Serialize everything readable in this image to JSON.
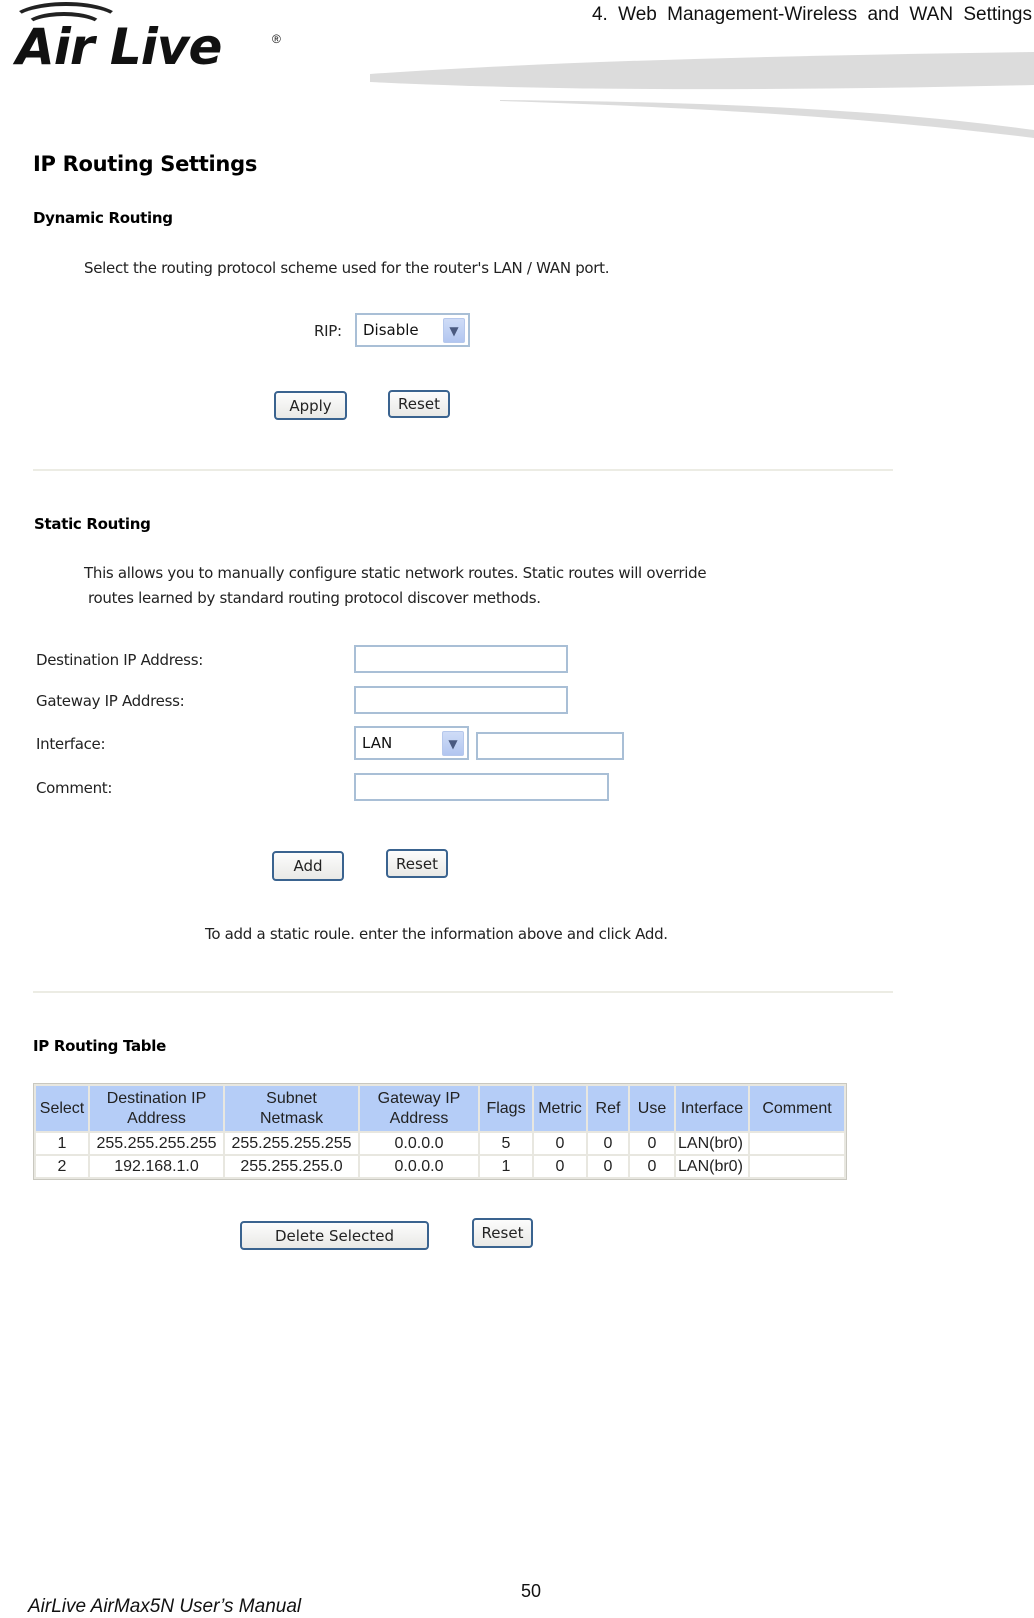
{
  "header": {
    "logo_text": "Air Live",
    "logo_mark": "®",
    "chapter_title": "4. Web Management-Wireless and WAN Settings"
  },
  "page": {
    "title": "IP Routing Settings",
    "dynamic_routing": {
      "heading": "Dynamic Routing",
      "description": "Select the routing protocol scheme used for the router's LAN / WAN port.",
      "rip_label": "RIP:",
      "rip_value": "Disable",
      "apply_label": "Apply",
      "reset_label": "Reset"
    },
    "static_routing": {
      "heading": "Static Routing",
      "description_line1": "This allows you to manually configure static network routes. Static routes will override",
      "description_line2": "routes learned by standard routing protocol discover methods.",
      "fields": {
        "destination_label": "Destination IP Address:",
        "destination_value": "",
        "gateway_label": "Gateway IP Address:",
        "gateway_value": "",
        "interface_label": "Interface:",
        "interface_value": "LAN",
        "interface_extra_value": "",
        "comment_label": "Comment:",
        "comment_value": ""
      },
      "add_label": "Add",
      "reset_label": "Reset",
      "hint": "To add a static roule. enter the information above and click Add."
    },
    "routing_table": {
      "heading": "IP Routing Table",
      "columns": [
        [
          "Select"
        ],
        [
          "Destination IP",
          "Address"
        ],
        [
          "Subnet",
          "Netmask"
        ],
        [
          "Gateway IP",
          "Address"
        ],
        [
          "Flags"
        ],
        [
          "Metric"
        ],
        [
          "Ref"
        ],
        [
          "Use"
        ],
        [
          "Interface"
        ],
        [
          "Comment"
        ]
      ],
      "rows": [
        [
          "1",
          "255.255.255.255",
          "255.255.255.255",
          "0.0.0.0",
          "5",
          "0",
          "0",
          "0",
          "LAN(br0)",
          ""
        ],
        [
          "2",
          "192.168.1.0",
          "255.255.255.0",
          "0.0.0.0",
          "1",
          "0",
          "0",
          "0",
          "LAN(br0)",
          ""
        ]
      ],
      "delete_label": "Delete Selected",
      "reset_label": "Reset"
    }
  },
  "footer": {
    "page_number": "50",
    "manual_title": "AirLive AirMax5N User’s Manual"
  },
  "colors": {
    "table_header_bg": "#b5cdf7",
    "button_border": "#3a638f",
    "input_border": "#a9bfd6"
  }
}
